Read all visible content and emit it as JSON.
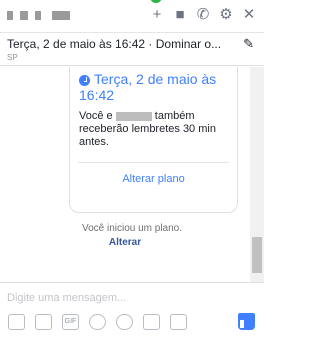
{
  "header": {
    "icons": [
      "add-icon",
      "video-call-icon",
      "phone-icon",
      "gear-icon",
      "close-icon"
    ],
    "plan_title": "Terça, 2 de maio às 16:42 · Dominar o...",
    "place": "SP"
  },
  "card": {
    "date": "Terça, 2 de maio às 16:42",
    "desc_pre": "Você e",
    "desc_post": "também receberão lembretes 30 min antes.",
    "change_label": "Alterar plano"
  },
  "notice": {
    "text": "Você iniciou um plano.",
    "link": "Alterar"
  },
  "composer": {
    "placeholder": "Digite uma mensagem...",
    "tools": [
      "photo-icon",
      "sticker-icon",
      "gif-icon",
      "emoji-icon",
      "attach-icon",
      "camera-icon",
      "clipboard-icon"
    ],
    "gif_label": "GIF"
  },
  "colors": {
    "accent": "#4080ff",
    "link": "#365899"
  }
}
